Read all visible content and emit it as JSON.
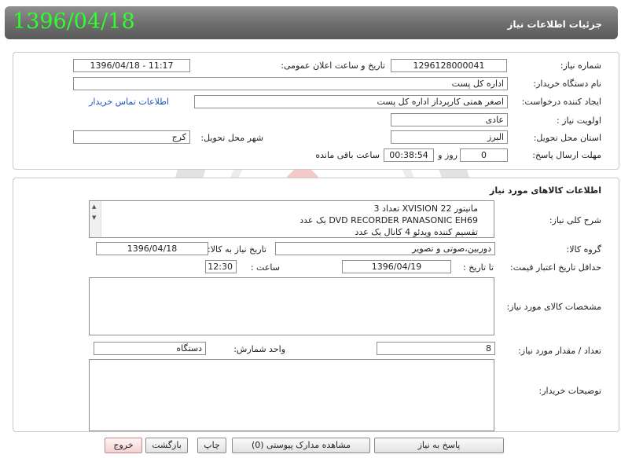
{
  "header": {
    "date": "1396/04/18",
    "title": "جزئیات اطلاعات نیاز"
  },
  "info": {
    "need_number_label": "شماره نیاز:",
    "need_number": "1296128000041",
    "announce_label": "تاریخ و ساعت اعلان عمومی:",
    "announce_value": "1396/04/18 - 11:17",
    "buyer_org_label": "نام دستگاه خریدار:",
    "buyer_org": "اداره کل پست",
    "requester_label": "ایجاد کننده درخواست:",
    "requester": "اصغر همتی کارپرداز اداره کل پست",
    "contact_link": "اطلاعات تماس خریدار",
    "priority_label": "اولویت نیاز :",
    "priority": "عادی",
    "province_label": "استان محل تحویل:",
    "province": "البرز",
    "city_label": "شهر محل تحویل:",
    "city": "کرج",
    "deadline_label": "مهلت ارسال پاسخ:",
    "days": "0",
    "days_suffix": "روز و",
    "time_remaining": "00:38:54",
    "remaining_suffix": "ساعت باقی مانده"
  },
  "goods": {
    "section_title": "اطلاعات کالاهای مورد نیاز",
    "general_desc_label": "شرح کلی نیاز:",
    "general_desc_lines": [
      "مانیتور XVISION 22 تعداد 3",
      "DVD RECORDER PANASONIC EH69 یک عدد",
      "تقسیم کننده ویدئو 4 کانال یک عدد"
    ],
    "group_label": "گروه کالا:",
    "group": "دوربین،صوتی و تصویر",
    "need_date_label": "تاریخ نیاز به کالا:",
    "need_date": "1396/04/18",
    "validity_label": "حداقل تاریخ اعتبار قیمت:",
    "to_date_label": "تا تاریخ :",
    "to_date": "1396/04/19",
    "time_label": "ساعت :",
    "time": "12:30",
    "specs_label": "مشخصات کالای مورد نیاز:",
    "quantity_label": "تعداد / مقدار مورد نیاز:",
    "quantity": "8",
    "unit_label": "واحد شمارش:",
    "unit": "دستگاه",
    "buyer_notes_label": "توضیحات خریدار:"
  },
  "actions": {
    "respond": "پاسخ به نیاز",
    "view_docs": "مشاهده مدارک پیوستی (0)",
    "print": "چاپ",
    "back": "بازگشت",
    "exit": "خروج"
  },
  "colors": {
    "date_green": "#2dff2d",
    "link_blue": "#1a56c4",
    "exit_red": "#f3d2d2"
  }
}
